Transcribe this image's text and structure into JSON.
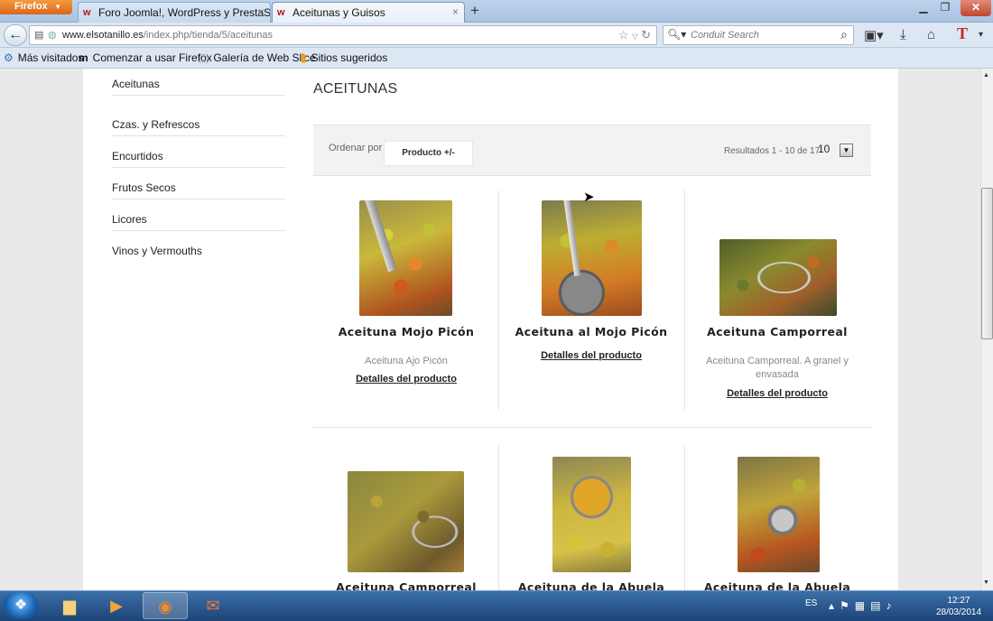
{
  "browser": {
    "menu_label": "Firefox",
    "tabs": [
      {
        "label": "Foro Joomla!, WordPress y PrestaSho...",
        "active": false
      },
      {
        "label": "Aceitunas y Guisos",
        "active": true
      }
    ],
    "url_domain": "www.elsotanillo.es",
    "url_path": "/index.php/tienda/5/aceitunas",
    "search_placeholder": "Conduit Search",
    "bookmarks": [
      "Más visitados",
      "Comenzar a usar Firefox",
      "Galería de Web Slice",
      "Sitios sugeridos"
    ]
  },
  "sidebar": {
    "items": [
      "Aceitunas",
      "Czas. y Refrescos",
      "Encurtidos",
      "Frutos Secos",
      "Licores",
      "Vinos y Vermouths"
    ]
  },
  "main": {
    "category_title": "ACEITUNAS",
    "order_label": "Ordenar por",
    "order_value": "Producto +/-",
    "results_text": "Resultados 1 - 10 de 17",
    "limit_value": "10"
  },
  "products": [
    {
      "name": "Aceituna Mojo Picón",
      "desc": "Aceituna Ajo Picón",
      "link": "Detalles del producto"
    },
    {
      "name": "Aceituna al Mojo Picón",
      "desc": "",
      "link": "Detalles del producto"
    },
    {
      "name": "Aceituna Camporreal",
      "desc": "Aceituna Camporreal. A granel y envasada",
      "link": "Detalles del producto"
    },
    {
      "name": "Aceituna Camporreal",
      "desc": "",
      "link": ""
    },
    {
      "name": "Aceituna de la Abuela",
      "desc": "",
      "link": ""
    },
    {
      "name": "Aceituna de la Abuela",
      "desc": "",
      "link": ""
    }
  ],
  "taskbar": {
    "lang": "ES",
    "time": "12:27",
    "date": "28/03/2014"
  },
  "colors": {
    "firefox_orange": "#e07a26",
    "taskbar_blue": "#2a5a92",
    "link_text": "#222222"
  }
}
